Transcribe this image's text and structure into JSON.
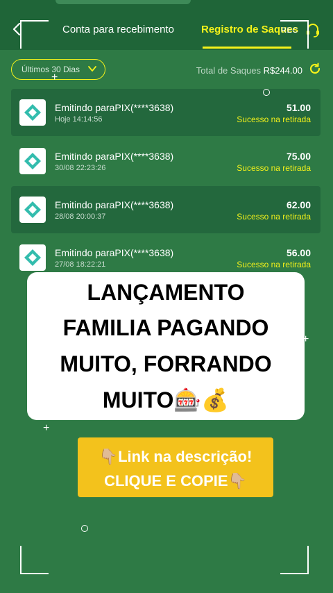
{
  "header": {
    "tab_conta": "Conta para recebimento",
    "tab_registro": "Registro de Saques",
    "rec_label": "REC"
  },
  "filters": {
    "period_label": "Últimos 30 Dias",
    "total_label": "Total de Saques",
    "total_amount": "R$244.00"
  },
  "transactions": [
    {
      "title": "Emitindo paraPIX(****3638)",
      "time": "Hoje 14:14:56",
      "amount": "51.00",
      "status": "Sucesso na retirada"
    },
    {
      "title": "Emitindo paraPIX(****3638)",
      "time": "30/08 22:23:26",
      "amount": "75.00",
      "status": "Sucesso na retirada"
    },
    {
      "title": "Emitindo paraPIX(****3638)",
      "time": "28/08 20:00:37",
      "amount": "62.00",
      "status": "Sucesso na retirada"
    },
    {
      "title": "Emitindo paraPIX(****3638)",
      "time": "27/08 18:22:21",
      "amount": "56.00",
      "status": "Sucesso na retirada"
    }
  ],
  "overlay": {
    "line1": "LANÇAMENTO",
    "line2": "FAMILIA PAGANDO",
    "line3": "MUITO, FORRANDO",
    "line4": "MUITO🎰💰"
  },
  "cta": {
    "line1": "👇🏼Link na descrição!",
    "line2": "CLIQUE E COPIE👇🏼"
  },
  "colors": {
    "background": "#2e7a45",
    "accent_yellow": "#f4f21a",
    "cta_yellow": "#f3c21c"
  },
  "icons": [
    "back-arrow-icon",
    "headset-icon",
    "chevron-down-icon",
    "refresh-icon",
    "pix-logo-icon"
  ]
}
